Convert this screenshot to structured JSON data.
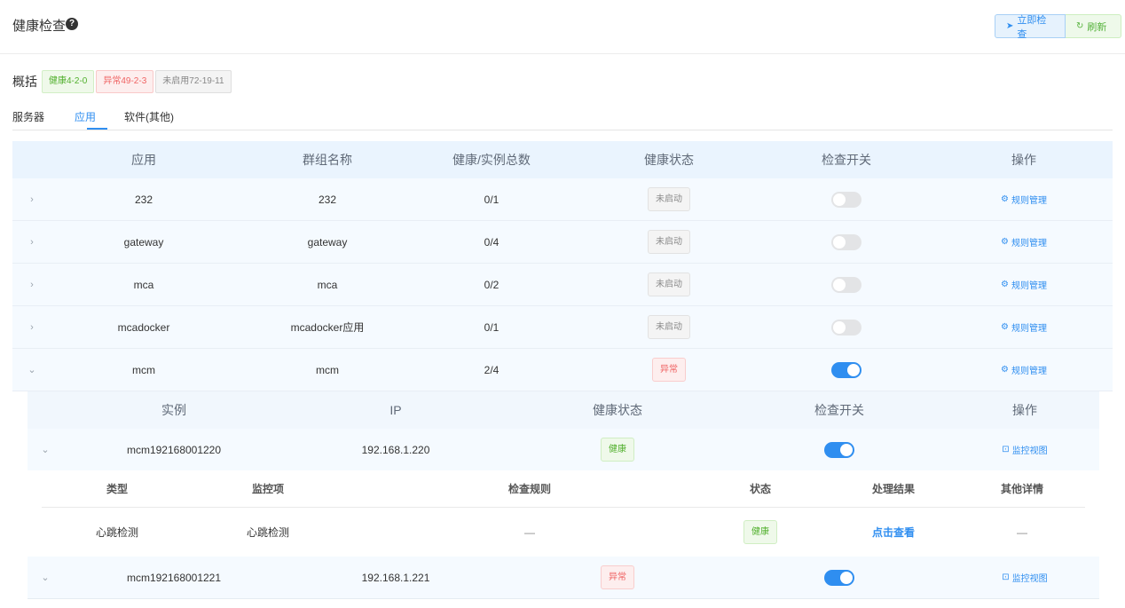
{
  "header": {
    "title": "健康检查",
    "help_icon": "?",
    "check_now_label": "立即检查",
    "refresh_label": "刷新"
  },
  "overview": {
    "label": "概括",
    "healthy_tag": "健康4-2-0",
    "abnormal_tag": "异常49-2-3",
    "disabled_tag": "未启用72-19-11"
  },
  "tabs": [
    "服务器",
    "应用",
    "软件(其他)"
  ],
  "active_tab": "应用",
  "app_table": {
    "columns": [
      "应用",
      "群组名称",
      "健康/实例总数",
      "健康状态",
      "检查开关",
      "操作"
    ],
    "action_label": "规则管理",
    "rows": [
      {
        "app": "232",
        "group": "232",
        "ratio": "0/1",
        "status": "未启动",
        "switch_on": false,
        "expanded": false
      },
      {
        "app": "gateway",
        "group": "gateway",
        "ratio": "0/4",
        "status": "未启动",
        "switch_on": false,
        "expanded": false
      },
      {
        "app": "mca",
        "group": "mca",
        "ratio": "0/2",
        "status": "未启动",
        "switch_on": false,
        "expanded": false
      },
      {
        "app": "mcadocker",
        "group": "mcadocker应用",
        "ratio": "0/1",
        "status": "未启动",
        "switch_on": false,
        "expanded": false
      },
      {
        "app": "mcm",
        "group": "mcm",
        "ratio": "2/4",
        "status": "异常",
        "switch_on": true,
        "expanded": true
      }
    ]
  },
  "instance_table": {
    "columns": [
      "实例",
      "IP",
      "健康状态",
      "检查开关",
      "操作"
    ],
    "action_label": "监控视图",
    "rows": [
      {
        "instance": "mcm192168001220",
        "ip": "192.168.1.220",
        "status": "健康",
        "switch_on": true
      },
      {
        "instance": "mcm192168001221",
        "ip": "192.168.1.221",
        "status": "异常",
        "switch_on": true
      }
    ]
  },
  "detail_table": {
    "columns": [
      "类型",
      "监控项",
      "检查规则",
      "状态",
      "处理结果",
      "其他详情"
    ],
    "rows": [
      {
        "type": "心跳检测",
        "item": "心跳检测",
        "rule": "—",
        "status": "健康",
        "result": "点击查看",
        "other": "—"
      }
    ]
  },
  "colors": {
    "accent": "#2f8ef0",
    "healthy": "#52b02e",
    "abnormal": "#ef6262",
    "disabled": "#8a8a8a"
  }
}
